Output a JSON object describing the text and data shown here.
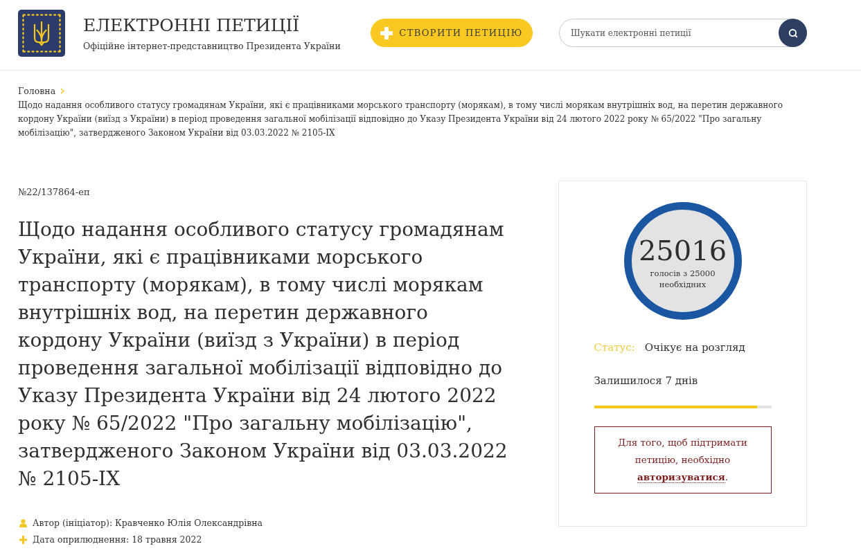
{
  "header": {
    "title": "ЕЛЕКТРОННІ ПЕТИЦІЇ",
    "subtitle": "Офіційне інтернет-представництво Президента України",
    "create_button": {
      "label": "СТВОРИТИ ПЕТИЦІЮ"
    },
    "search": {
      "placeholder": "Шукати електронні петиції"
    }
  },
  "breadcrumb": [
    {
      "label": "Головна",
      "kind": "link"
    },
    {
      "label": "Щодо надання особливого статусу громадянам України, які є працівниками морського транспорту (морякам), в тому числі морякам внутрішніх вод, на перетин державного кордону України (виїзд з України) в період проведення загальної мобілізації відповідно до Указу Президента України від 24 лютого 2022 року № 65/2022 \"Про загальну мобілізацію\", затвердженого Законом України від 03.03.2022 № 2105-IX",
      "kind": "current"
    }
  ],
  "petition": {
    "number": "№22/137864-еп",
    "title": "Щодо надання особливого статусу громадянам України, які є працівниками морського транспорту (морякам), в тому числі морякам внутрішніх вод, на перетин державного кордону України (виїзд з України) в період проведення загальної мобілізації відповідно до Указу Президента України від 24 лютого 2022 року № 65/2022 \"Про загальну мобілізацію\", затвердженого Законом України від 03.03.2022 № 2105-IX",
    "meta": [
      {
        "kind": "author",
        "text": "Автор (ініціатор): Кравченко Юлія Олександрівна"
      },
      {
        "kind": "date",
        "text": "Дата оприлюднення: 18 травня 2022"
      }
    ]
  },
  "votes": {
    "count": "25016",
    "caption": "голосів з 25000 необхідних",
    "status_label": "Статус:",
    "status": "Очікує на розгляд",
    "remaining": "Залишилося 7 днів",
    "time_bar": {
      "level": 0.92
    },
    "auth_notice": {
      "text": "Для того, щоб підтримати петицію, необхідно",
      "link": "авторизуватися",
      "after": "."
    }
  }
}
